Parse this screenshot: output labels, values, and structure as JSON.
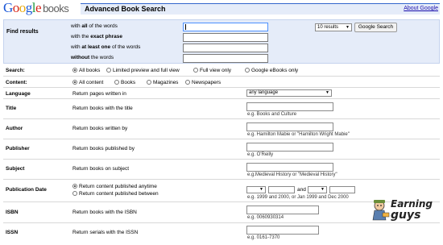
{
  "header": {
    "logo_google": [
      "G",
      "o",
      "o",
      "g",
      "l",
      "e"
    ],
    "logo_books": "books",
    "title": "Advanced Book Search",
    "about_link": "About Google"
  },
  "find": {
    "label": "Find results",
    "rows": [
      {
        "pre": "with ",
        "bold": "all",
        "post": " of the words"
      },
      {
        "pre": "with the ",
        "bold": "exact phrase",
        "post": ""
      },
      {
        "pre": "with ",
        "bold": "at least one",
        "post": " of the words"
      },
      {
        "pre": "",
        "bold": "without",
        "post": " the words"
      }
    ],
    "results_select": "10 results",
    "search_button": "Google Search"
  },
  "search": {
    "label": "Search:",
    "options": [
      "All books",
      "Limited preview and full view",
      "Full view only",
      "Google eBooks only"
    ],
    "selected": 0
  },
  "content": {
    "label": "Content:",
    "options": [
      "All content",
      "Books",
      "Magazines",
      "Newspapers"
    ],
    "selected": 0
  },
  "language": {
    "label": "Language",
    "desc": "Return pages written in",
    "value": "any language"
  },
  "title": {
    "label": "Title",
    "desc": "Return books with the title",
    "hint": "e.g. Books and Culture"
  },
  "author": {
    "label": "Author",
    "desc": "Return books written by",
    "hint": "e.g. Hamilton Mabie or \"Hamilton Wright Mabie\""
  },
  "publisher": {
    "label": "Publisher",
    "desc": "Return books published by",
    "hint": "e.g. O'Reilly"
  },
  "subject": {
    "label": "Subject",
    "desc": "Return books on subject",
    "hint": "e.g.Medieval History or \"Medieval History\""
  },
  "pubdate": {
    "label": "Publication Date",
    "opt1": "Return content published anytime",
    "opt2": "Return content published between",
    "and": "and",
    "hint": "e.g. 1999 and 2000, or Jan 1999 and Dec 2000"
  },
  "isbn": {
    "label": "ISBN",
    "desc": "Return books with the ISBN",
    "hint": "e.g. 0060930314"
  },
  "issn": {
    "label": "ISSN",
    "desc": "Return serials with the ISSN",
    "hint": "e.g. 0161-7370"
  },
  "watermark": {
    "line1": "Earning",
    "line2": "guys"
  },
  "colors": {
    "accent_blue": "#3366cc",
    "panel_bg": "#e5ecf9",
    "link": "#1a0dab"
  }
}
